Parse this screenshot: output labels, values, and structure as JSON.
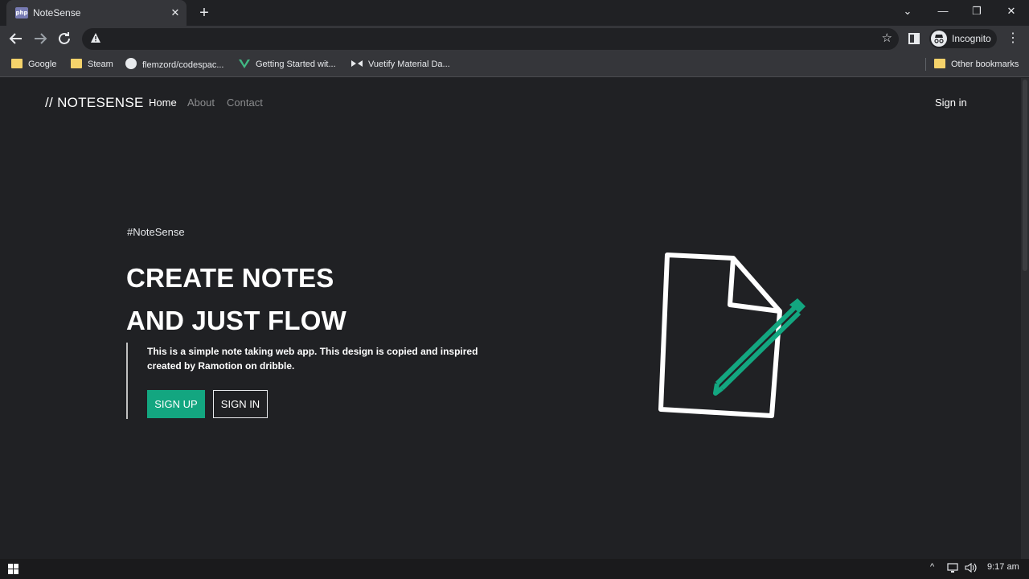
{
  "browser": {
    "tab_title": "NoteSense",
    "tab_favicon": "php",
    "tab_close": "✕",
    "new_tab": "+",
    "window_controls": {
      "dropdown": "⌄",
      "minimize": "—",
      "restore": "❐",
      "close": "✕"
    },
    "omnibox_url": "",
    "profile_label": "Incognito",
    "bookmarks": [
      {
        "label": "Google",
        "icon": "folder-icon"
      },
      {
        "label": "Steam",
        "icon": "folder-icon"
      },
      {
        "label": "flemzord/codespac...",
        "icon": "github-icon"
      },
      {
        "label": "Getting Started wit...",
        "icon": "vue-icon"
      },
      {
        "label": "Vuetify Material Da...",
        "icon": "bowtie-icon"
      }
    ],
    "other_bookmarks": "Other bookmarks"
  },
  "site": {
    "brand": "// NOTESENSE",
    "nav": [
      {
        "label": "Home",
        "active": true
      },
      {
        "label": "About",
        "active": false
      },
      {
        "label": "Contact",
        "active": false
      }
    ],
    "signin_link": "Sign in"
  },
  "hero": {
    "hashtag": "#NoteSense",
    "headline_line1": "CREATE NOTES",
    "headline_line2": "AND JUST FLOW",
    "description": "This is a simple note taking web app. This design is copied and inspired created by Ramotion on dribble.",
    "signup_label": "SIGN UP",
    "signin_label": "SIGN IN",
    "accent_color": "#13a680",
    "illustration": "note-with-pencil-icon"
  },
  "taskbar": {
    "time": "9:17 am"
  }
}
